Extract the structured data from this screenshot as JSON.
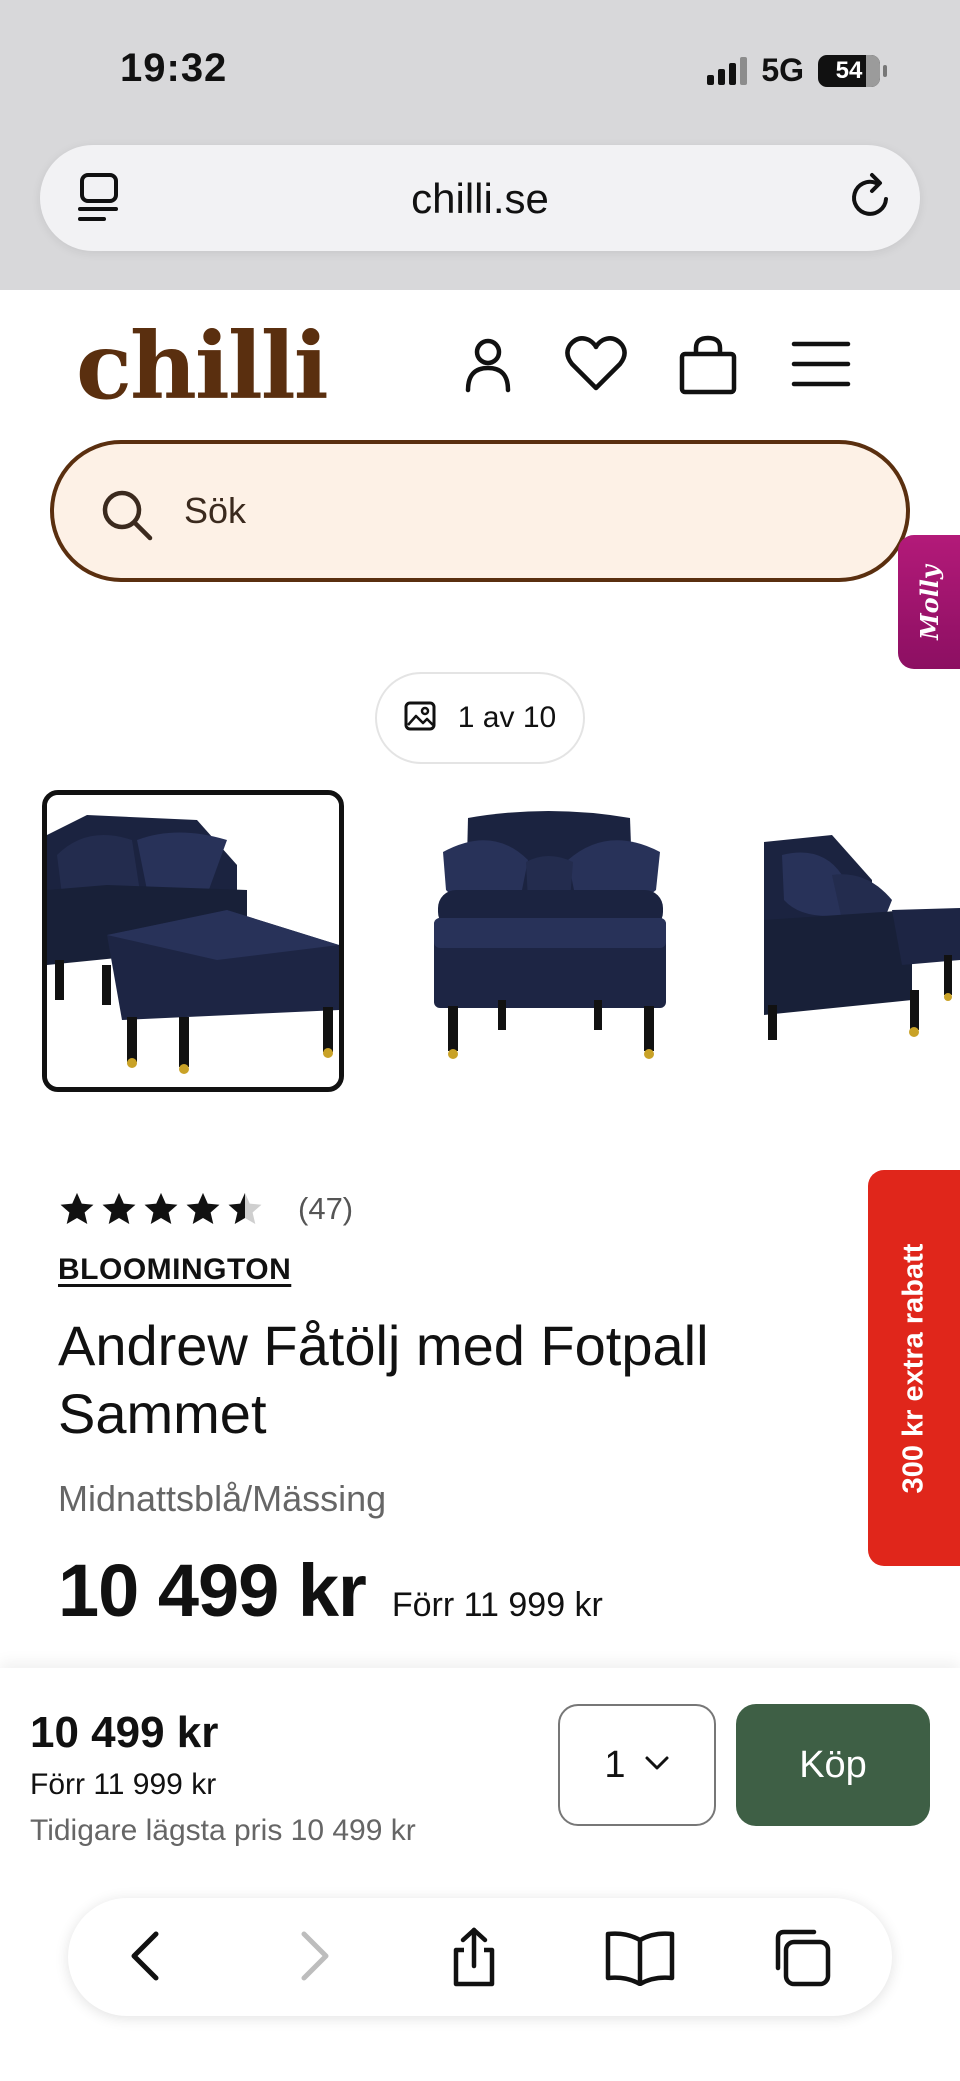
{
  "status_bar": {
    "time": "19:32",
    "network": "5G",
    "battery": "54"
  },
  "browser": {
    "url": "chilli.se"
  },
  "site": {
    "logo": "chilli",
    "search_placeholder": "Sök",
    "molly_label": "Molly"
  },
  "gallery": {
    "counter": "1 av 10"
  },
  "product": {
    "rating_value": 4.5,
    "rating_count": "(47)",
    "brand": "BLOOMINGTON",
    "title": "Andrew Fåtölj med Fotpall Sammet",
    "variant": "Midnattsblå/Mässing",
    "price": "10 499 kr",
    "previous_price": "Förr 11 999 kr"
  },
  "promo_tab": "300 kr extra rabatt",
  "buy_bar": {
    "price": "10 499 kr",
    "previous_price": "Förr 11 999 kr",
    "lowest_price": "Tidigare lägsta pris 10 499 kr",
    "quantity": "1",
    "buy_label": "Köp"
  },
  "colors": {
    "brand_brown": "#5a2f0f",
    "search_bg": "#fdf1e6",
    "buy_green": "#3e5f45",
    "promo_red": "#e0261b",
    "molly_magenta": "#a3166f",
    "sofa_navy": "#1b2340"
  }
}
